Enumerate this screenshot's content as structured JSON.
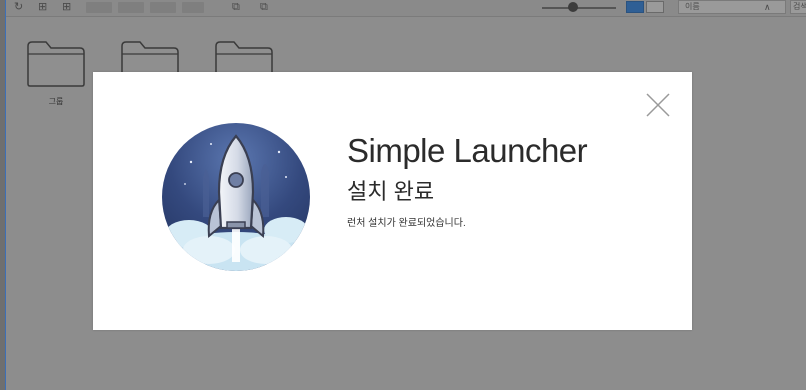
{
  "folders": [
    {
      "label": "그룹"
    },
    {
      "label": ""
    },
    {
      "label": ""
    }
  ],
  "toolbar": {
    "sort_label": "이름",
    "search_placeholder": "검색"
  },
  "dialog": {
    "app_name": "Simple Launcher",
    "title": "설치 완료",
    "message": "런처 설치가 완료되었습니다.",
    "close_icon": "close-icon"
  },
  "colors": {
    "overlay": "#8d8d8d",
    "accent": "#2f5f95",
    "logo_sky": "#2c3e6d"
  }
}
